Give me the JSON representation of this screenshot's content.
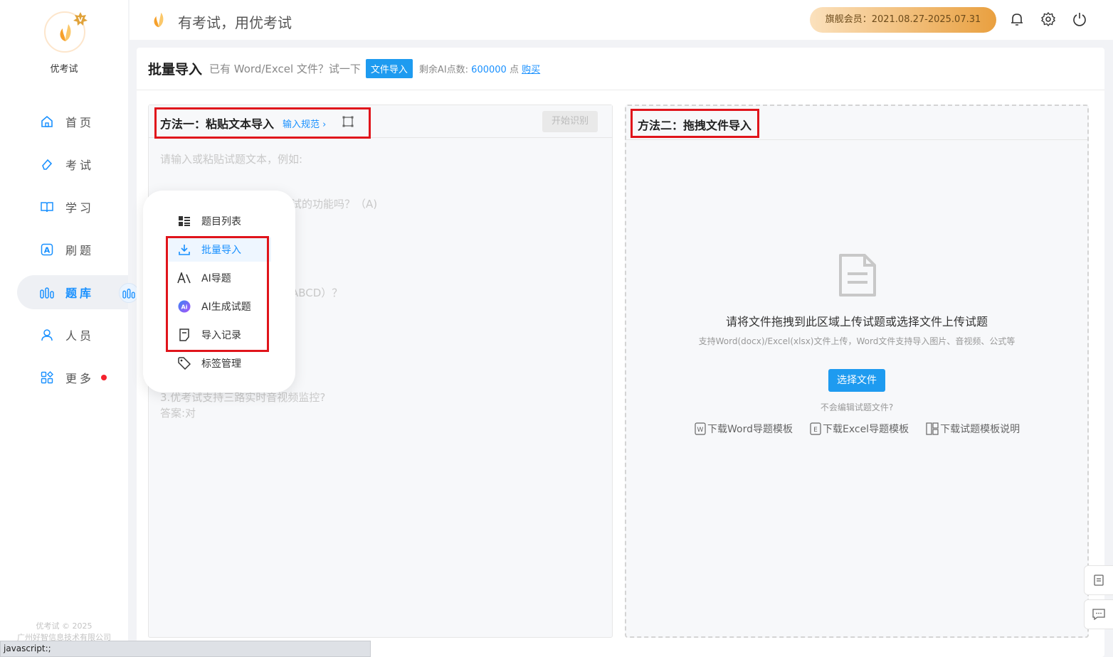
{
  "app": {
    "logo_name": "优考试",
    "slogan": "有考试，用优考试",
    "membership": "旗舰会员：2021.08.27-2025.07.31"
  },
  "sidebar": {
    "items": [
      {
        "label": "首页",
        "icon": "home-icon"
      },
      {
        "label": "考试",
        "icon": "eraser-icon"
      },
      {
        "label": "学习",
        "icon": "book-icon"
      },
      {
        "label": "刷题",
        "icon": "letter-a-icon"
      },
      {
        "label": "题库",
        "icon": "bar-chart-icon"
      },
      {
        "label": "人员",
        "icon": "user-icon"
      },
      {
        "label": "更多",
        "icon": "apps-icon"
      }
    ],
    "active": "题库",
    "footer_line1": "优考试 © 2025",
    "footer_line2": "广州好智信息技术有限公司"
  },
  "header": {
    "title": "批量导入",
    "hint": "已有 Word/Excel 文件？试一下",
    "file_import_button": "文件导入",
    "ai_points_label": "剩余AI点数:",
    "ai_points_value": "600000",
    "ai_points_unit": "点",
    "buy_link": "购买"
  },
  "method1": {
    "title": "方法一：粘贴文本导入",
    "spec_link": "输入规范",
    "start_button": "开始识别",
    "placeholder_lines": [
      "请输入或粘贴试题文本，例如:",
      "试的功能吗？（A)",
      "ABCD）？",
      "3.优考试支持三路实时音视频监控?",
      "答案:对"
    ]
  },
  "method2": {
    "title": "方法二：拖拽文件导入",
    "main_text": "请将文件拖拽到此区域上传试题或选择文件上传试题",
    "sub_text": "支持Word(docx)/Excel(xlsx)文件上传，Word文件支持导入图片、音视频、公式等",
    "select_button": "选择文件",
    "help_text": "不会编辑试题文件?",
    "links": [
      "下载Word导题模板",
      "下载Excel导题模板",
      "下载试题模板说明"
    ]
  },
  "popup_menu": {
    "items": [
      {
        "label": "题目列表",
        "icon": "list-icon"
      },
      {
        "label": "批量导入",
        "icon": "download-icon"
      },
      {
        "label": "AI导题",
        "icon": "ai-text-icon"
      },
      {
        "label": "AI生成试题",
        "icon": "ai-badge-icon"
      },
      {
        "label": "导入记录",
        "icon": "note-icon"
      },
      {
        "label": "标签管理",
        "icon": "tag-icon"
      }
    ],
    "active": "批量导入"
  },
  "status_bar": "javascript:;",
  "colors": {
    "accent": "#1890ff",
    "highlight": "#e0141b",
    "member_gold": "#e9a040"
  }
}
